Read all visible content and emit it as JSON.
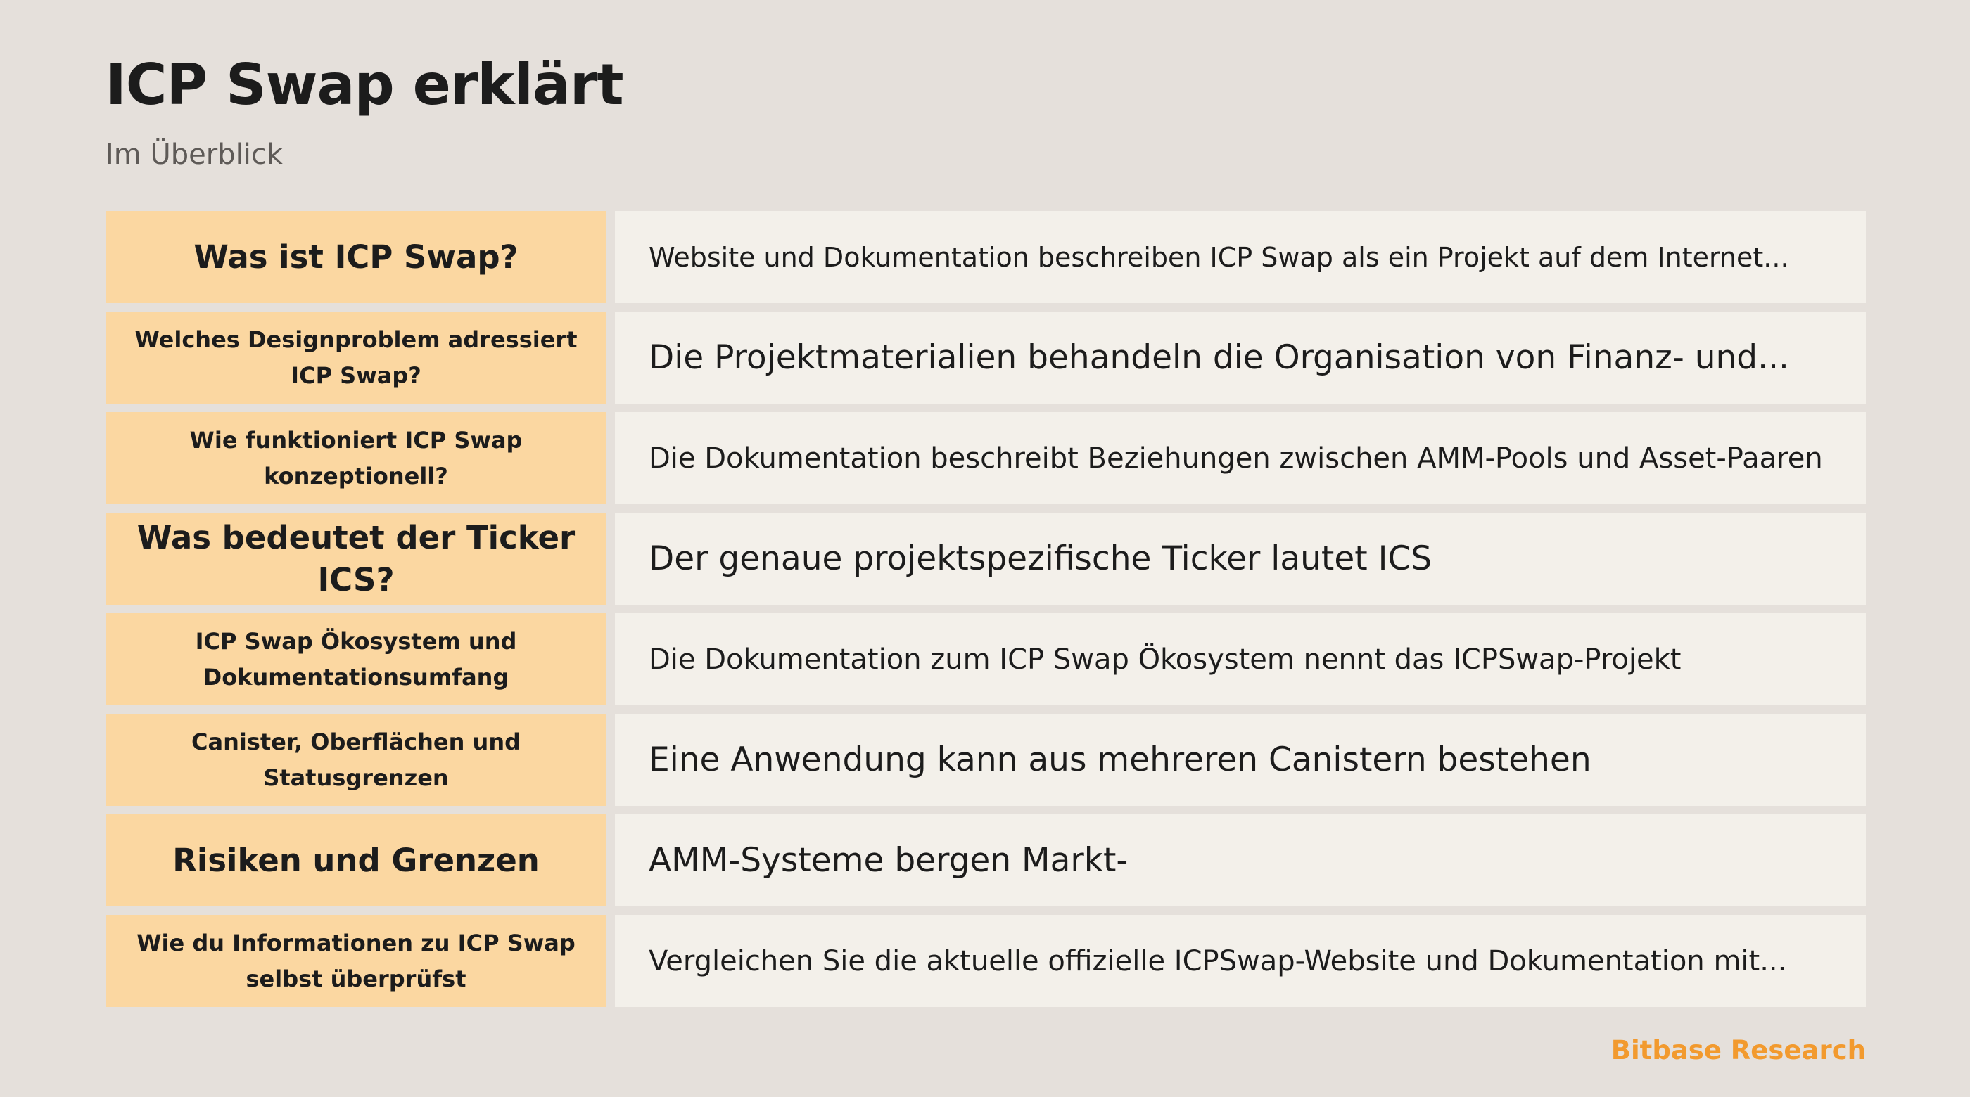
{
  "header": {
    "title": "ICP Swap erklärt",
    "subtitle": "Im Überblick"
  },
  "rows": [
    {
      "question": "Was ist ICP Swap?",
      "answer": "Website und Dokumentation beschreiben ICP Swap als ein Projekt auf dem Internet..."
    },
    {
      "question": "Welches Designproblem adressiert ICP Swap?",
      "answer": "Die Projektmaterialien behandeln die Organisation von Finanz- und..."
    },
    {
      "question": "Wie funktioniert ICP Swap konzeptionell?",
      "answer": "Die Dokumentation beschreibt Beziehungen zwischen AMM-Pools und Asset-Paaren"
    },
    {
      "question": "Was bedeutet der Ticker ICS?",
      "answer": "Der genaue projektspezifische Ticker lautet ICS"
    },
    {
      "question": "ICP Swap Ökosystem und Dokumentationsumfang",
      "answer": "Die Dokumentation zum ICP Swap Ökosystem nennt das ICPSwap-Projekt"
    },
    {
      "question": "Canister, Oberflächen und Statusgrenzen",
      "answer": "Eine Anwendung kann aus mehreren Canistern bestehen"
    },
    {
      "question": "Risiken und Grenzen",
      "answer": "AMM-Systeme bergen Markt-"
    },
    {
      "question": "Wie du Informationen zu ICP Swap selbst überprüfst",
      "answer": "Vergleichen Sie die aktuelle offizielle ICPSwap-Website und Dokumentation mit..."
    }
  ],
  "footer": {
    "brand": "Bitbase Research"
  },
  "colors": {
    "background": "#e5e0db",
    "question_cell": "#fbd7a1",
    "answer_cell": "#f3f0ea",
    "brand_accent": "#f29a2e"
  }
}
